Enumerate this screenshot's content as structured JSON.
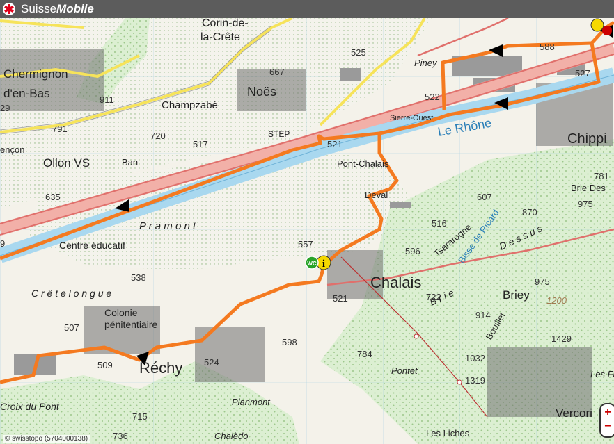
{
  "header": {
    "brand_light": "Suisse",
    "brand_bold": "Mobile"
  },
  "colors": {
    "route": "#f47a20",
    "river": "#a9d8ef",
    "forest": "#d8eccd",
    "road_yellow": "#f6e35a",
    "road_red": "#e0706c",
    "topbar": "#5c5c5c"
  },
  "map": {
    "places": {
      "corin": "Corin-de-",
      "corin2": "la-Crête",
      "chermignon": "Chermignon",
      "enbas": "d'en-Bas",
      "noes": "Noës",
      "champzabe": "Champzabé",
      "ollon": "Ollon VS",
      "ban": "Ban",
      "encon": "ençon",
      "step": "STEP",
      "rhone": "Le Rhône",
      "pontchalais": "Pont-Chalais",
      "deval": "Deval",
      "pramont": "P r a m o n t",
      "centre": "Centre éducatif",
      "cretelongue": "C r ê t e l o n g u e",
      "colonie": "Colonie",
      "penitentiaire": "pénitentiaire",
      "rechy": "Réchy",
      "chalais": "Chalais",
      "chippis": "Chippi",
      "briedes": "Brie Des",
      "tsararogne": "Tsararogne",
      "bisse": "Bisse de Ricard",
      "briey": "Briey",
      "bouillet": "Bouillet",
      "dessus": "D e s s u s",
      "brie": "B r i e",
      "planmont": "Planmont",
      "pontet": "Pontet",
      "chaledo": "Chalèdo",
      "croix": "Croix du Pont",
      "lesliches": "Les Liches",
      "vercorin": "Vercori",
      "lesfl": "Les Fl",
      "piney": "Piney",
      "sierre": "Sierre-Ouest"
    },
    "elevations": {
      "e525": "525",
      "e667": "667",
      "e911": "911",
      "e29": "29",
      "e791": "791",
      "e720": "720",
      "e517": "517",
      "e635": "635",
      "e521a": "521",
      "e522": "522",
      "e588": "588",
      "e527": "527",
      "e607": "607",
      "e781": "781",
      "e975a": "975",
      "e870": "870",
      "e516": "516",
      "e596": "596",
      "e557": "557",
      "e538": "538",
      "e521b": "521",
      "e507": "507",
      "e509": "509",
      "e598": "598",
      "e524": "524",
      "e784": "784",
      "e722": "722",
      "e914": "914",
      "e975b": "975",
      "e1200": "1200",
      "e1429": "1429",
      "e1032": "1032",
      "e1319": "1319",
      "e736": "736",
      "e715": "715",
      "e9": "9"
    },
    "info_marker": "i",
    "wc_marker": "WC"
  },
  "zoom": {
    "in_label": "+",
    "out_label": "−"
  },
  "copyright": "© swisstopo (5704000138)"
}
